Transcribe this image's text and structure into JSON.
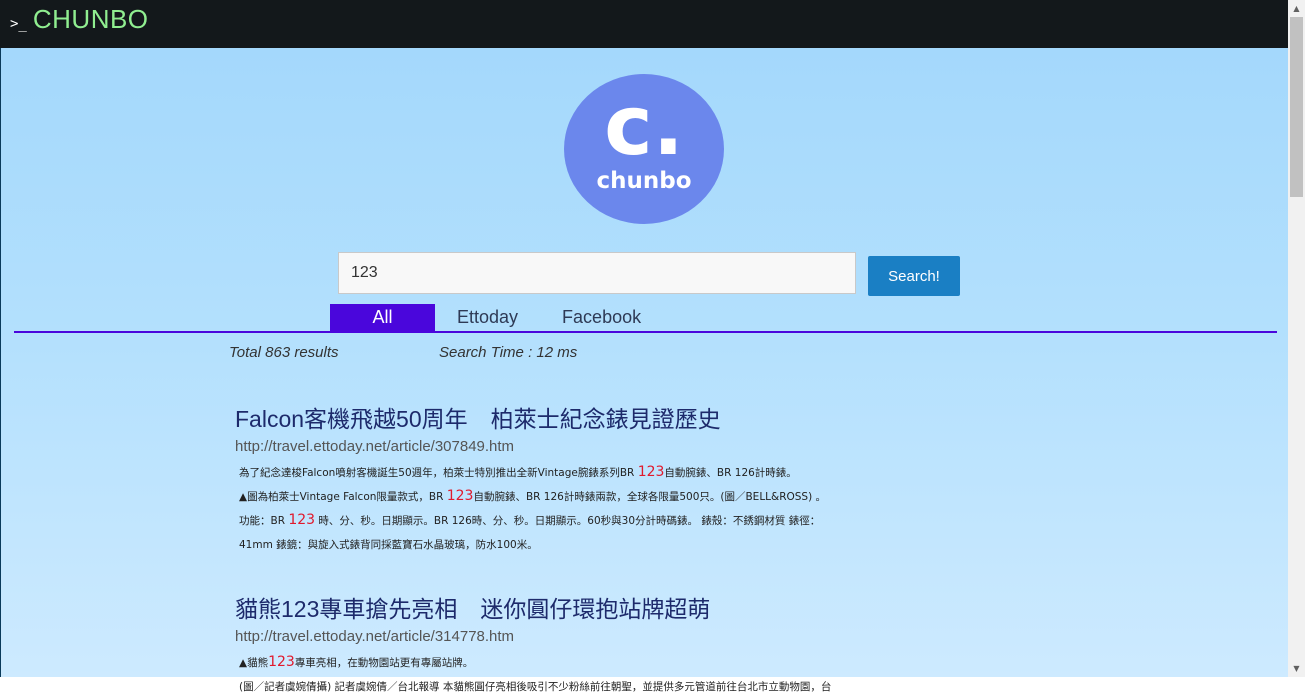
{
  "header": {
    "prompt": ">_",
    "brand": "CHUNBO"
  },
  "logo": {
    "letter": "c.",
    "word": "chunbo"
  },
  "search": {
    "value": "123",
    "button_label": "Search!"
  },
  "tabs": [
    {
      "label": "All",
      "active": true
    },
    {
      "label": "Ettoday",
      "active": false
    },
    {
      "label": "Facebook",
      "active": false
    }
  ],
  "stats": {
    "total": "Total 863 results",
    "time": "Search Time : 12 ms"
  },
  "results": [
    {
      "title": "Falcon客機飛越50周年　柏萊士紀念錶見證歷史",
      "url": "http://travel.ettoday.net/article/307849.htm",
      "snippet": [
        {
          "before": "為了紀念達梭Falcon噴射客機誕生50週年，柏萊士特別推出全新Vintage腕錶系列BR ",
          "hl": "123",
          "after": "自動腕錶、BR 126計時錶。"
        },
        {
          "before": "▲圖為柏萊士Vintage Falcon限量款式，BR ",
          "hl": "123",
          "after": "自動腕錶、BR 126計時錶兩款，全球各限量500只。(圖／BELL&ROSS) 。"
        },
        {
          "before": "功能：BR ",
          "hl": "123",
          "after": " 時、分、秒。日期顯示。BR 126時、分、秒。日期顯示。60秒與30分計時碼錶。 錶殼：不銹鋼材質 錶徑："
        },
        {
          "before": "41mm 錶鏡：與旋入式錶背同採藍寶石水晶玻璃，防水100米。",
          "hl": "",
          "after": ""
        }
      ]
    },
    {
      "title": "貓熊123專車搶先亮相　迷你圓仔環抱站牌超萌",
      "url": "http://travel.ettoday.net/article/314778.htm",
      "snippet": [
        {
          "before": "▲貓熊",
          "hl": "123",
          "after": "專車亮相，在動物園站更有專屬站牌。"
        },
        {
          "before": "(圖／記者虞婉倩攝) 記者虞婉倩／台北報導 本貓熊圓仔亮相後吸引不少粉絲前往朝聖，並提供多元管道前往台北市立動物園，台",
          "hl": "",
          "after": ""
        }
      ]
    }
  ]
}
